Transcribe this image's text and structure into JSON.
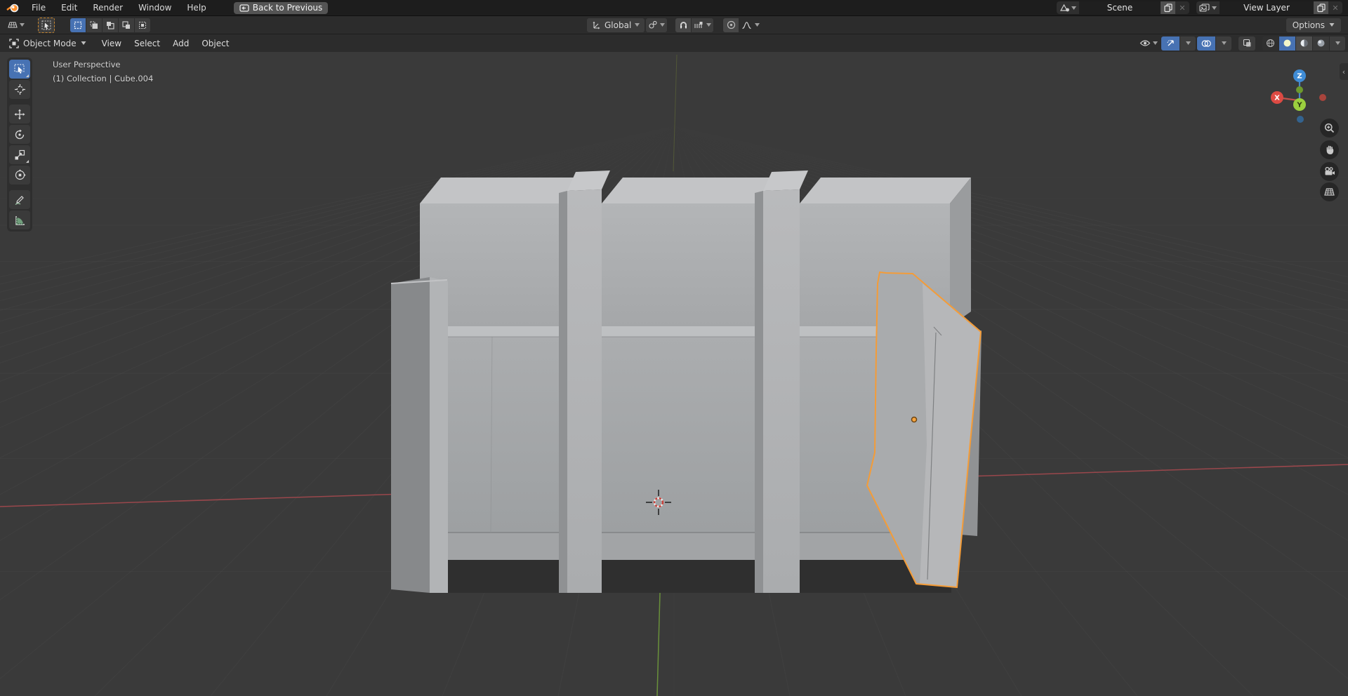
{
  "topbar": {
    "menus": {
      "file": "File",
      "edit": "Edit",
      "render": "Render",
      "window": "Window",
      "help": "Help"
    },
    "back_button": "Back to Previous",
    "scene": {
      "value": "Scene"
    },
    "view_layer": {
      "value": "View Layer"
    }
  },
  "tool_settings": {
    "orientation": "Global",
    "options": "Options"
  },
  "viewport_header": {
    "mode": "Object Mode",
    "view": "View",
    "select": "Select",
    "add": "Add",
    "object": "Object"
  },
  "viewport_overlay": {
    "perspective_label": "User Perspective",
    "breadcrumb": "(1) Collection | Cube.004"
  },
  "gizmo": {
    "z": "Z",
    "x": "X",
    "y": "Y"
  },
  "selection": {
    "active_object": "Cube.004"
  },
  "colors": {
    "accent_blue": "#4772b3",
    "selection_orange": "#f49c38",
    "viewport_bg": "#3a3a3a",
    "header_bg": "#2c2c2c",
    "topbar_bg": "#1d1d1d",
    "axis_x_red": "#a5494e",
    "axis_y_green": "#6f9a3a"
  }
}
